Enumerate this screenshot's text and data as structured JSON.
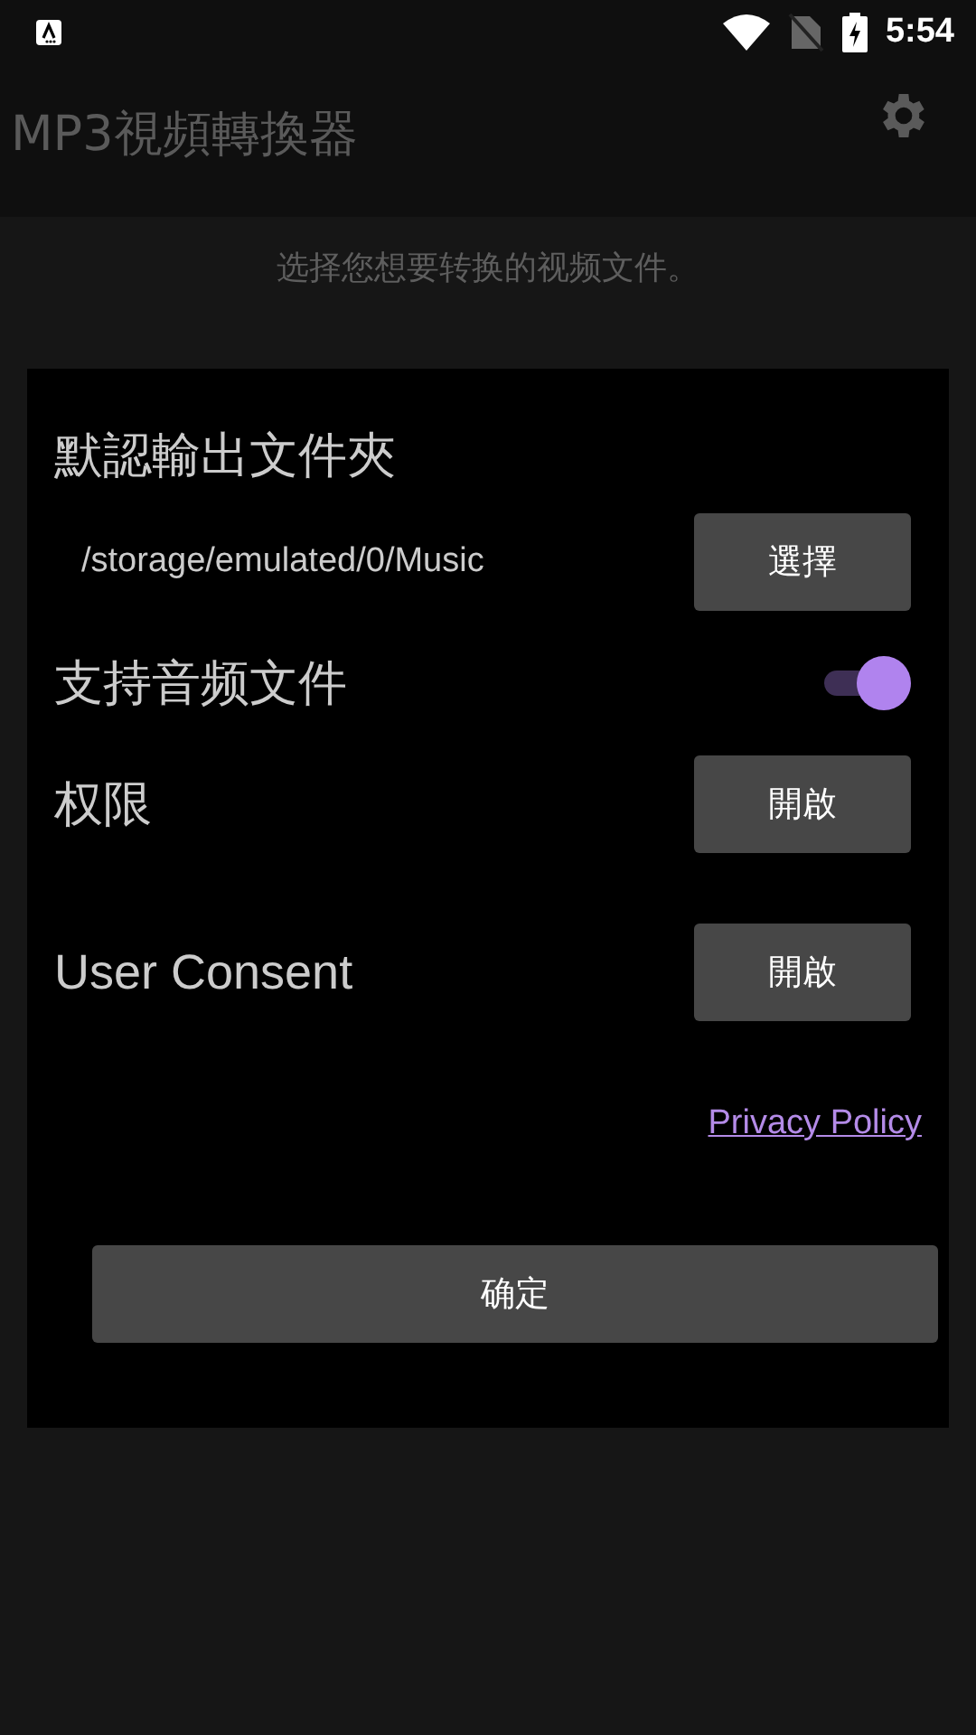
{
  "status_bar": {
    "time": "5:54"
  },
  "app_bar": {
    "title": "MP3視頻轉換器"
  },
  "subtitle": "选择您想要转换的视频文件。",
  "dialog": {
    "heading": "默認輸出文件夾",
    "path": "/storage/emulated/0/Music",
    "choose_button": "選擇",
    "audio_toggle": {
      "label": "支持音频文件",
      "on": true
    },
    "rows": [
      {
        "label": "权限",
        "button": "開啟"
      },
      {
        "label": "User Consent",
        "button": "開啟"
      }
    ],
    "privacy_link": "Privacy Policy",
    "confirm_button": "确定"
  }
}
